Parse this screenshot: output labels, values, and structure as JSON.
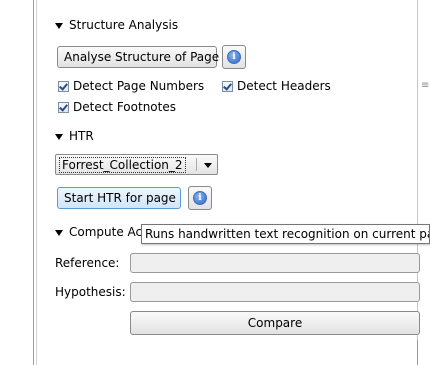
{
  "structure_analysis": {
    "header": "Structure Analysis",
    "analyse_button": "Analyse Structure of Page",
    "info_icon": "info-icon",
    "checkboxes": [
      {
        "label": "Detect Page Numbers",
        "checked": true
      },
      {
        "label": "Detect Headers",
        "checked": true
      },
      {
        "label": "Detect Footnotes",
        "checked": true
      }
    ]
  },
  "htr": {
    "header": "HTR",
    "model_select_value": "Forrest_Collection_2",
    "start_button": "Start HTR for page"
  },
  "compute_accuracy": {
    "header": "Compute Ac",
    "reference_label": "Reference:",
    "hypothesis_label": "Hypothesis:",
    "compare_button": "Compare"
  },
  "tooltip": {
    "text": "Runs handwritten text recognition on current page"
  },
  "colors": {
    "focus_border": "#5b9bd5",
    "info_blue": "#2c63c7"
  }
}
